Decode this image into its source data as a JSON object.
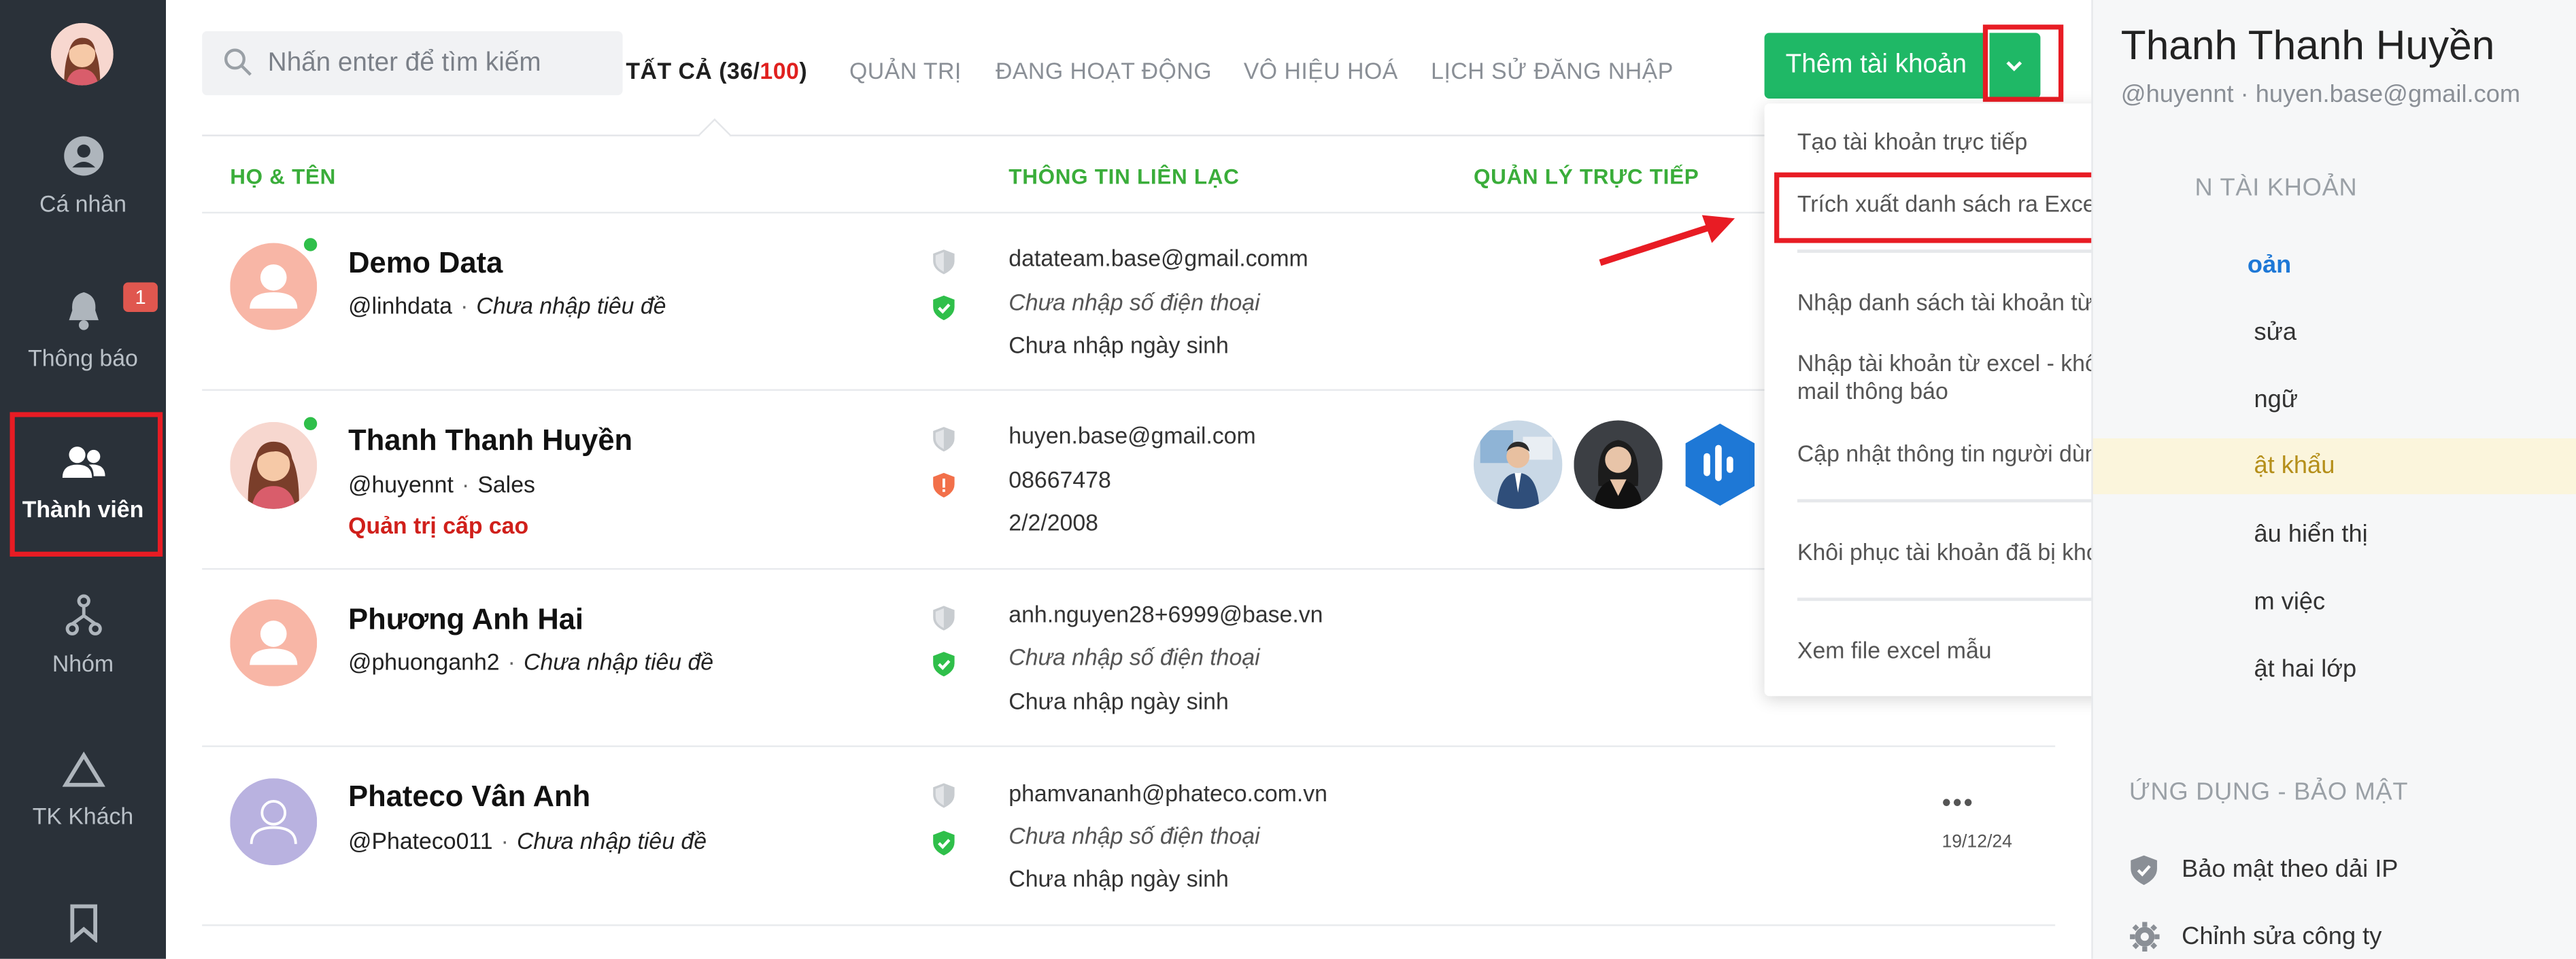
{
  "nav": {
    "items": [
      {
        "label": "Cá nhân",
        "icon": "user-circle-icon"
      },
      {
        "label": "Thông báo",
        "icon": "bell-icon",
        "badge": "1"
      },
      {
        "label": "Thành viên",
        "icon": "members-icon",
        "active": true
      },
      {
        "label": "Nhóm",
        "icon": "group-tree-icon"
      },
      {
        "label": "TK Khách",
        "icon": "triangle-icon"
      },
      {
        "label": "",
        "icon": "bookmark-icon"
      }
    ]
  },
  "search": {
    "placeholder": "Nhấn enter để tìm kiếm"
  },
  "tabs": {
    "all_prefix": "TẤT CẢ (36/",
    "all_limit": "100",
    "all_suffix": ")",
    "admin": "QUẢN TRỊ",
    "active": "ĐANG HOẠT ĐỘNG",
    "disabled": "VÔ HIỆU HOÁ",
    "login_history": "LỊCH SỬ ĐĂNG NHẬP"
  },
  "add_button": {
    "label": "Thêm tài khoản"
  },
  "table": {
    "headers": {
      "name": "HỌ & TÊN",
      "contact": "THÔNG TIN LIÊN LẠC",
      "manager": "QUẢN LÝ TRỰC TIẾP"
    },
    "rows": [
      {
        "name": "Demo Data",
        "handle": "@linhdata",
        "title": "Chưa nhập tiêu đề",
        "email": "datateam.base@gmail.comm",
        "phone": "Chưa nhập số điện thoại",
        "birthday": "Chưa nhập ngày sinh"
      },
      {
        "name": "Thanh Thanh Huyền",
        "handle": "@huyennt",
        "title": "Sales",
        "role": "Quản trị cấp cao",
        "email": "huyen.base@gmail.com",
        "phone": "08667478",
        "birthday": "2/2/2008"
      },
      {
        "name": "Phương Anh Hai",
        "handle": "@phuonganh2",
        "title": "Chưa nhập tiêu đề",
        "email": "anh.nguyen28+6999@base.vn",
        "phone": "Chưa nhập số điện thoại",
        "birthday": "Chưa nhập ngày sinh"
      },
      {
        "name": "Phateco Vân Anh",
        "handle": "@Phateco011",
        "title": "Chưa nhập tiêu đề",
        "email": "phamvananh@phateco.com.vn",
        "phone": "Chưa nhập số điện thoại",
        "birthday": "Chưa nhập ngày sinh",
        "more": "•••",
        "date": "19/12/24"
      }
    ]
  },
  "dropdown": {
    "items": [
      "Tạo tài khoản trực tiếp",
      "Trích xuất danh sách ra Excel",
      "Nhập danh sách tài khoản từ Excel",
      "Nhập tài khoản từ excel - không gửi mail thông báo",
      "Cập nhật thông tin người dùng từ Excel",
      "Khôi phục tài khoản đã bị khóa",
      "Xem file excel mẫu"
    ]
  },
  "right_panel": {
    "name": "Thanh Thanh Huyền",
    "handle": "@huyennt",
    "email": "huyen.base@gmail.com",
    "section1": "N TÀI KHOẢN",
    "items": [
      "oản",
      "sửa",
      "ngữ",
      "ật khẩu",
      "âu hiển thị",
      "m việc",
      "ật hai lớp"
    ],
    "section2": "ỨNG DỤNG - BẢO MẬT",
    "bottom": [
      "Bảo mật theo dải IP",
      "Chỉnh sửa công ty"
    ]
  },
  "colors": {
    "accent_green": "#1fb866",
    "nav_bg": "#2a3139",
    "highlight_red": "#e81c24"
  }
}
